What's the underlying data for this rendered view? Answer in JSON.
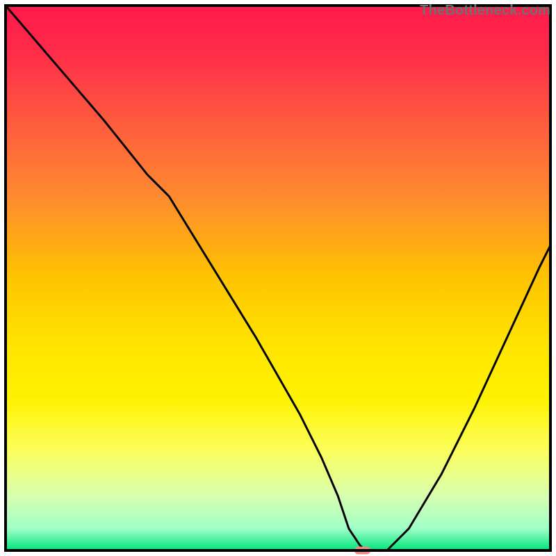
{
  "watermark": "TheBottleneck.com",
  "chart_data": {
    "type": "line",
    "title": "",
    "xlabel": "",
    "ylabel": "",
    "xlim": [
      0,
      100
    ],
    "ylim": [
      0,
      100
    ],
    "axes_visible": false,
    "grid": false,
    "background": {
      "type": "vertical-gradient",
      "stops": [
        {
          "position": 0.0,
          "color": "#ff1a4b"
        },
        {
          "position": 0.08,
          "color": "#ff2a4a"
        },
        {
          "position": 0.2,
          "color": "#ff5640"
        },
        {
          "position": 0.35,
          "color": "#ff8a30"
        },
        {
          "position": 0.5,
          "color": "#ffc400"
        },
        {
          "position": 0.62,
          "color": "#ffe400"
        },
        {
          "position": 0.72,
          "color": "#fff200"
        },
        {
          "position": 0.82,
          "color": "#fbff60"
        },
        {
          "position": 0.9,
          "color": "#d8ffb0"
        },
        {
          "position": 0.96,
          "color": "#a0ffc8"
        },
        {
          "position": 1.0,
          "color": "#00e37a"
        }
      ]
    },
    "series": [
      {
        "name": "bottleneck-curve",
        "stroke": "#000000",
        "stroke_width": 3,
        "x": [
          0,
          6,
          12,
          18,
          22,
          26,
          30,
          38,
          46,
          54,
          58,
          61,
          63,
          65,
          66,
          70,
          74,
          80,
          86,
          92,
          98,
          100
        ],
        "y": [
          100,
          93,
          86,
          79,
          74,
          69,
          65,
          52,
          39,
          25,
          17,
          10,
          4,
          1,
          0,
          0,
          4,
          14,
          26,
          39,
          52,
          56
        ]
      }
    ],
    "marker": {
      "shape": "rounded-rect",
      "center_x": 65.5,
      "center_y": 0,
      "width_pct": 3.0,
      "height_pct": 1.4,
      "color": "#e88a8a"
    },
    "plot_frame": {
      "stroke": "#000000",
      "stroke_width": 4
    }
  }
}
